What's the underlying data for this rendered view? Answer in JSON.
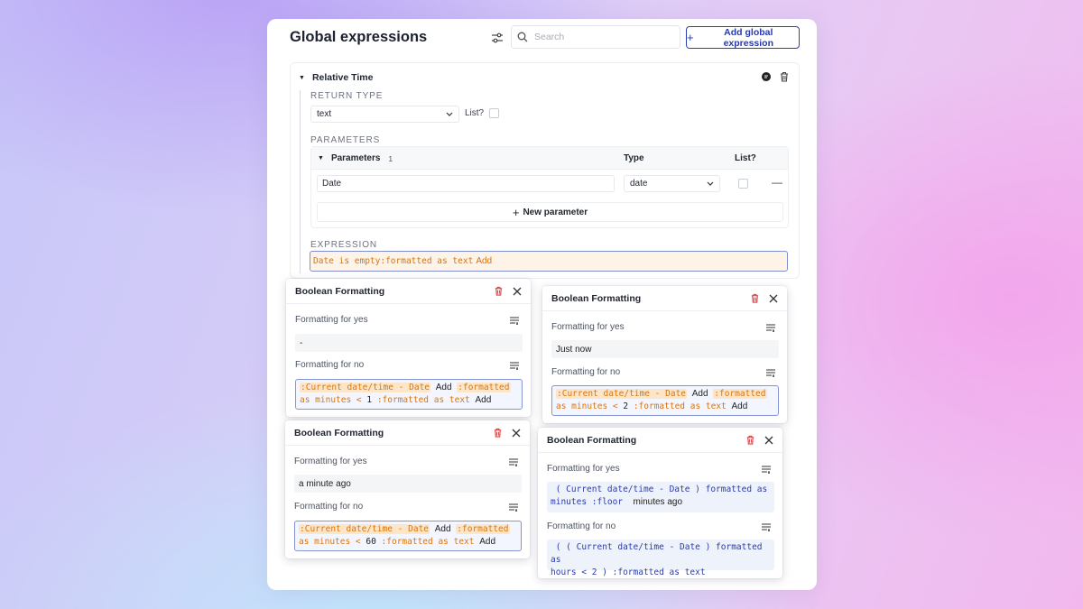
{
  "header": {
    "title": "Global expressions",
    "search_placeholder": "Search",
    "add_label": "Add global expression"
  },
  "expression": {
    "name": "Relative Time",
    "return_type_label": "RETURN TYPE",
    "return_type_value": "text",
    "list_label": "List?",
    "parameters_label": "PARAMETERS",
    "params_table": {
      "header_label": "Parameters",
      "count": "1",
      "type_header": "Type",
      "list_header": "List?",
      "rows": [
        {
          "name": "Date",
          "type": "date"
        }
      ],
      "new_param_label": "New parameter"
    },
    "expression_label": "EXPRESSION",
    "expression_tokens": [
      "Date is empty",
      ":formatted as text"
    ],
    "expression_add": "Add"
  },
  "popups": [
    {
      "title": "Boolean Formatting",
      "yes_label": "Formatting for yes",
      "yes_value": "-",
      "no_label": "Formatting for no",
      "no_tokens": {
        "t1": "Current date/time - Date",
        "add1": "Add",
        "t2a": "formatted",
        "t2b": "as minutes < ",
        "num": "1",
        "t3": ":formatted as text",
        "add2": "Add"
      }
    },
    {
      "title": "Boolean Formatting",
      "yes_label": "Formatting for yes",
      "yes_value": "Just now",
      "no_label": "Formatting for no",
      "no_tokens": {
        "t1": "Current date/time - Date",
        "add1": "Add",
        "t2a": "formatted",
        "t2b": "as minutes < ",
        "num": "2",
        "t3": ":formatted as text",
        "add2": "Add"
      }
    },
    {
      "title": "Boolean Formatting",
      "yes_label": "Formatting for yes",
      "yes_value": "a minute ago",
      "no_label": "Formatting for no",
      "no_tokens": {
        "t1": "Current date/time - Date",
        "add1": "Add",
        "t2a": "formatted",
        "t2b": "as minutes < ",
        "num": "60",
        "t3": ":formatted as text",
        "add2": "Add"
      }
    },
    {
      "title": "Boolean Formatting",
      "yes_label": "Formatting for yes",
      "yes_line1": "( Current date/time  -  Date ) formatted as",
      "yes_line2": "minutes :floor",
      "yes_suffix": "minutes ago",
      "no_label": "Formatting for no",
      "no_line1": "( ( Current date/time  -  Date ) formatted as",
      "no_line2": "hours  <  2 ) :formatted as text"
    }
  ],
  "colors": {
    "accent": "#2a3aa8",
    "token_orange": "#d9740e",
    "token_bg": "#fde6c8",
    "delete_red": "#d93b3b"
  }
}
